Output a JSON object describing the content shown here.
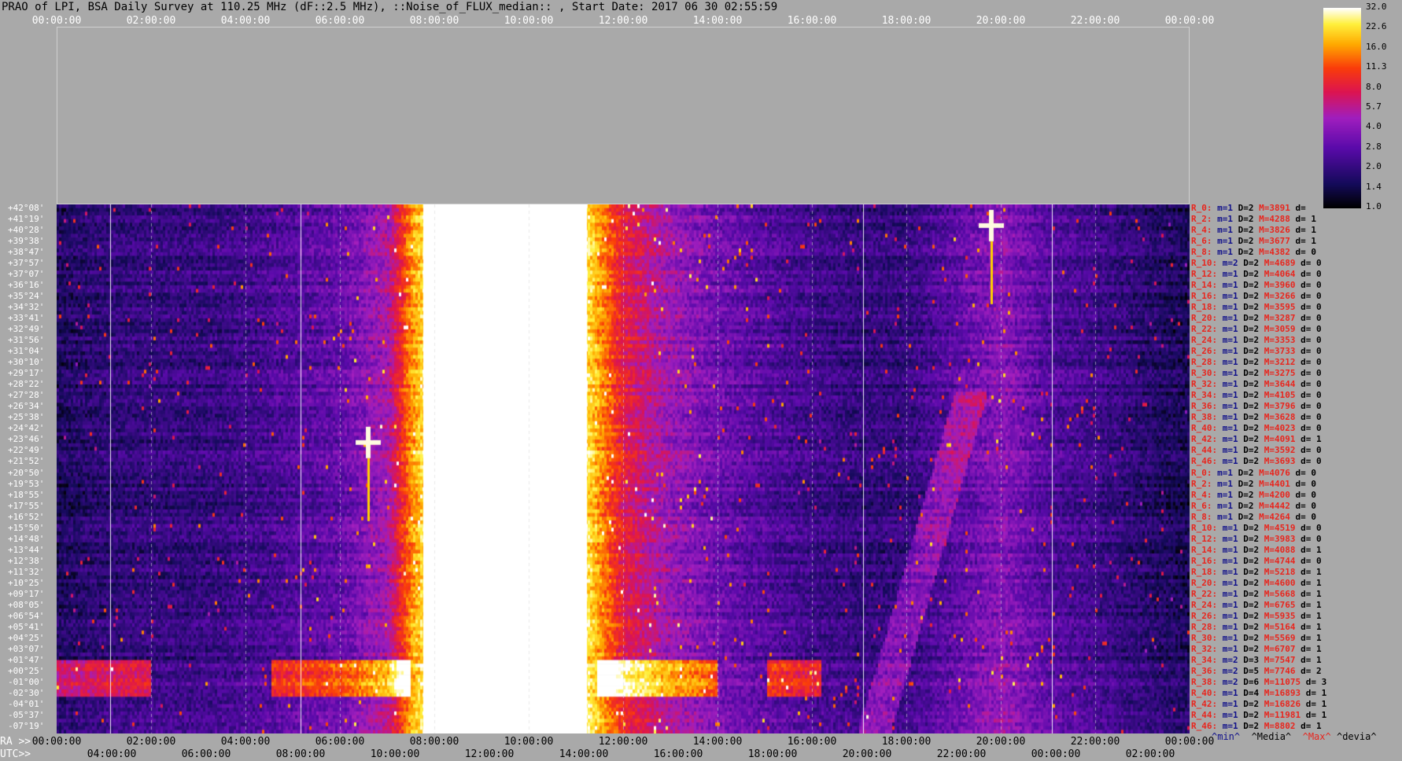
{
  "title": "PRAO of LPI, BSA Daily Survey at 110.25 MHz (dF::2.5 MHz), ::Noise_of_FLUX_median:: , Start Date: 2017 06 30 02:55:59",
  "axis_top_ticks": [
    "00:00:00",
    "02:00:00",
    "04:00:00",
    "06:00:00",
    "08:00:00",
    "10:00:00",
    "12:00:00",
    "14:00:00",
    "16:00:00",
    "18:00:00",
    "20:00:00",
    "22:00:00",
    "00:00:00"
  ],
  "ra_label": "RA >>",
  "utc_label": "UTC>>",
  "axis_ra_ticks": [
    "00:00:00",
    "02:00:00",
    "04:00:00",
    "06:00:00",
    "08:00:00",
    "10:00:00",
    "12:00:00",
    "14:00:00",
    "16:00:00",
    "18:00:00",
    "20:00:00",
    "22:00:00",
    "00:00:00"
  ],
  "axis_utc_ticks": [
    "04:00:00",
    "06:00:00",
    "08:00:00",
    "10:00:00",
    "12:00:00",
    "14:00:00",
    "16:00:00",
    "18:00:00",
    "20:00:00",
    "22:00:00",
    "00:00:00",
    "02:00:00"
  ],
  "declinations": [
    "+42°08'",
    "+41°19'",
    "+40°28'",
    "+39°38'",
    "+38°47'",
    "+37°57'",
    "+37°07'",
    "+36°16'",
    "+35°24'",
    "+34°32'",
    "+33°41'",
    "+32°49'",
    "+31°56'",
    "+31°04'",
    "+30°10'",
    "+29°17'",
    "+28°22'",
    "+27°28'",
    "+26°34'",
    "+25°38'",
    "+24°42'",
    "+23°46'",
    "+22°49'",
    "+21°52'",
    "+20°50'",
    "+19°53'",
    "+18°55'",
    "+17°55'",
    "+16°52'",
    "+15°50'",
    "+14°48'",
    "+13°44'",
    "+12°38'",
    "+11°32'",
    "+10°25'",
    "+09°17'",
    "+08°05'",
    "+06°54'",
    "+05°41'",
    "+04°25'",
    "+03°07'",
    "+01°47'",
    "+00°25'",
    "-01°00'",
    "-02°30'",
    "-04°01'",
    "-05°37'",
    "-07°19'"
  ],
  "stats": [
    {
      "r": "R_0:",
      "m": "m=1",
      "D": "D=2",
      "M": "M=3891",
      "d": "d="
    },
    {
      "r": "R_2:",
      "m": "m=1",
      "D": "D=2",
      "M": "M=4288",
      "d": "d= 1"
    },
    {
      "r": "R_4:",
      "m": "m=1",
      "D": "D=2",
      "M": "M=3826",
      "d": "d= 1"
    },
    {
      "r": "R_6:",
      "m": "m=1",
      "D": "D=2",
      "M": "M=3677",
      "d": "d= 1"
    },
    {
      "r": "R_8:",
      "m": "m=1",
      "D": "D=2",
      "M": "M=4382",
      "d": "d= 0"
    },
    {
      "r": "R_10:",
      "m": "m=2",
      "D": "D=2",
      "M": "M=4689",
      "d": "d= 0"
    },
    {
      "r": "R_12:",
      "m": "m=1",
      "D": "D=2",
      "M": "M=4064",
      "d": "d= 0"
    },
    {
      "r": "R_14:",
      "m": "m=1",
      "D": "D=2",
      "M": "M=3960",
      "d": "d= 0"
    },
    {
      "r": "R_16:",
      "m": "m=1",
      "D": "D=2",
      "M": "M=3266",
      "d": "d= 0"
    },
    {
      "r": "R_18:",
      "m": "m=1",
      "D": "D=2",
      "M": "M=3595",
      "d": "d= 0"
    },
    {
      "r": "R_20:",
      "m": "m=1",
      "D": "D=2",
      "M": "M=3287",
      "d": "d= 0"
    },
    {
      "r": "R_22:",
      "m": "m=1",
      "D": "D=2",
      "M": "M=3059",
      "d": "d= 0"
    },
    {
      "r": "R_24:",
      "m": "m=1",
      "D": "D=2",
      "M": "M=3353",
      "d": "d= 0"
    },
    {
      "r": "R_26:",
      "m": "m=1",
      "D": "D=2",
      "M": "M=3733",
      "d": "d= 0"
    },
    {
      "r": "R_28:",
      "m": "m=1",
      "D": "D=2",
      "M": "M=3212",
      "d": "d= 0"
    },
    {
      "r": "R_30:",
      "m": "m=1",
      "D": "D=2",
      "M": "M=3275",
      "d": "d= 0"
    },
    {
      "r": "R_32:",
      "m": "m=1",
      "D": "D=2",
      "M": "M=3644",
      "d": "d= 0"
    },
    {
      "r": "R_34:",
      "m": "m=1",
      "D": "D=2",
      "M": "M=4105",
      "d": "d= 0"
    },
    {
      "r": "R_36:",
      "m": "m=1",
      "D": "D=2",
      "M": "M=3796",
      "d": "d= 0"
    },
    {
      "r": "R_38:",
      "m": "m=1",
      "D": "D=2",
      "M": "M=3628",
      "d": "d= 0"
    },
    {
      "r": "R_40:",
      "m": "m=1",
      "D": "D=2",
      "M": "M=4023",
      "d": "d= 0"
    },
    {
      "r": "R_42:",
      "m": "m=1",
      "D": "D=2",
      "M": "M=4091",
      "d": "d= 1"
    },
    {
      "r": "R_44:",
      "m": "m=1",
      "D": "D=2",
      "M": "M=3592",
      "d": "d= 0"
    },
    {
      "r": "R_46:",
      "m": "m=1",
      "D": "D=2",
      "M": "M=3693",
      "d": "d= 0"
    },
    {
      "r": "R_0:",
      "m": "m=1",
      "D": "D=2",
      "M": "M=4076",
      "d": "d= 0"
    },
    {
      "r": "R_2:",
      "m": "m=1",
      "D": "D=2",
      "M": "M=4401",
      "d": "d= 0"
    },
    {
      "r": "R_4:",
      "m": "m=1",
      "D": "D=2",
      "M": "M=4200",
      "d": "d= 0"
    },
    {
      "r": "R_6:",
      "m": "m=1",
      "D": "D=2",
      "M": "M=4442",
      "d": "d= 0"
    },
    {
      "r": "R_8:",
      "m": "m=1",
      "D": "D=2",
      "M": "M=4264",
      "d": "d= 0"
    },
    {
      "r": "R_10:",
      "m": "m=1",
      "D": "D=2",
      "M": "M=4519",
      "d": "d= 0"
    },
    {
      "r": "R_12:",
      "m": "m=1",
      "D": "D=2",
      "M": "M=3983",
      "d": "d= 0"
    },
    {
      "r": "R_14:",
      "m": "m=1",
      "D": "D=2",
      "M": "M=4088",
      "d": "d= 1"
    },
    {
      "r": "R_16:",
      "m": "m=1",
      "D": "D=2",
      "M": "M=4744",
      "d": "d= 0"
    },
    {
      "r": "R_18:",
      "m": "m=1",
      "D": "D=2",
      "M": "M=5218",
      "d": "d= 1"
    },
    {
      "r": "R_20:",
      "m": "m=1",
      "D": "D=2",
      "M": "M=4600",
      "d": "d= 1"
    },
    {
      "r": "R_22:",
      "m": "m=1",
      "D": "D=2",
      "M": "M=5668",
      "d": "d= 1"
    },
    {
      "r": "R_24:",
      "m": "m=1",
      "D": "D=2",
      "M": "M=6765",
      "d": "d= 1"
    },
    {
      "r": "R_26:",
      "m": "m=1",
      "D": "D=2",
      "M": "M=5935",
      "d": "d= 1"
    },
    {
      "r": "R_28:",
      "m": "m=1",
      "D": "D=2",
      "M": "M=5164",
      "d": "d= 1"
    },
    {
      "r": "R_30:",
      "m": "m=1",
      "D": "D=2",
      "M": "M=5569",
      "d": "d= 1"
    },
    {
      "r": "R_32:",
      "m": "m=1",
      "D": "D=2",
      "M": "M=6707",
      "d": "d= 1"
    },
    {
      "r": "R_34:",
      "m": "m=2",
      "D": "D=3",
      "M": "M=7547",
      "d": "d= 1"
    },
    {
      "r": "R_36:",
      "m": "m=2",
      "D": "D=5",
      "M": "M=7746",
      "d": "d= 2"
    },
    {
      "r": "R_38:",
      "m": "m=2",
      "D": "D=6",
      "M": "M=11075",
      "d": "d= 3"
    },
    {
      "r": "R_40:",
      "m": "m=1",
      "D": "D=4",
      "M": "M=16893",
      "d": "d= 1"
    },
    {
      "r": "R_42:",
      "m": "m=1",
      "D": "D=2",
      "M": "M=16826",
      "d": "d= 1"
    },
    {
      "r": "R_44:",
      "m": "m=1",
      "D": "D=2",
      "M": "M=11981",
      "d": "d= 1"
    },
    {
      "r": "R_46:",
      "m": "m=1",
      "D": "D=2",
      "M": "M=8802",
      "d": "d= 1"
    }
  ],
  "legend": {
    "min": "^min^",
    "median": "^Media^",
    "max": "^Max^",
    "dev": "^devia^"
  },
  "colorbar": {
    "ticks": [
      "32.0",
      "22.6",
      "16.0",
      "11.3",
      "8.0",
      "5.7",
      "4.0",
      "2.8",
      "2.0",
      "1.4",
      "1.0"
    ]
  },
  "chart_data": {
    "type": "heatmap",
    "title": "PRAO of LPI, BSA Daily Survey at 110.25 MHz (dF::2.5 MHz), ::Noise_of_FLUX_median:: , Start Date: 2017 06 30 02:55:59",
    "x_ticks_ra": [
      "00:00:00",
      "02:00:00",
      "04:00:00",
      "06:00:00",
      "08:00:00",
      "10:00:00",
      "12:00:00",
      "14:00:00",
      "16:00:00",
      "18:00:00",
      "20:00:00",
      "22:00:00",
      "00:00:00"
    ],
    "x_ticks_utc": [
      "04:00:00",
      "06:00:00",
      "08:00:00",
      "10:00:00",
      "12:00:00",
      "14:00:00",
      "16:00:00",
      "18:00:00",
      "20:00:00",
      "22:00:00",
      "00:00:00",
      "02:00:00"
    ],
    "y_ticks": "declinations",
    "color_scale": {
      "min": 1.0,
      "max": 32.0,
      "scale": "log2",
      "colormap": "gnuplot-like black-purple-red-yellow-white"
    },
    "features": [
      {
        "name": "saturated band",
        "ra_start_h": 7.6,
        "ra_end_h": 11.4,
        "value": 32.0
      },
      {
        "name": "equatorial bright row",
        "dec_row": 43,
        "value": 22.6
      }
    ],
    "column_profile_ra_h": [
      0,
      1,
      2,
      3,
      4,
      5,
      6,
      7,
      7.5,
      8,
      9,
      10,
      11,
      11.5,
      12,
      13,
      14,
      15,
      16,
      17,
      18,
      19,
      20,
      21,
      22,
      23,
      24
    ],
    "column_profile_value": [
      1.6,
      1.9,
      2.0,
      2.0,
      2.2,
      2.6,
      3.0,
      5.0,
      16.0,
      32.0,
      32.0,
      32.0,
      32.0,
      16.0,
      8.0,
      4.5,
      3.2,
      2.6,
      2.2,
      2.0,
      2.0,
      2.8,
      4.0,
      2.6,
      2.2,
      1.8,
      1.5
    ]
  }
}
